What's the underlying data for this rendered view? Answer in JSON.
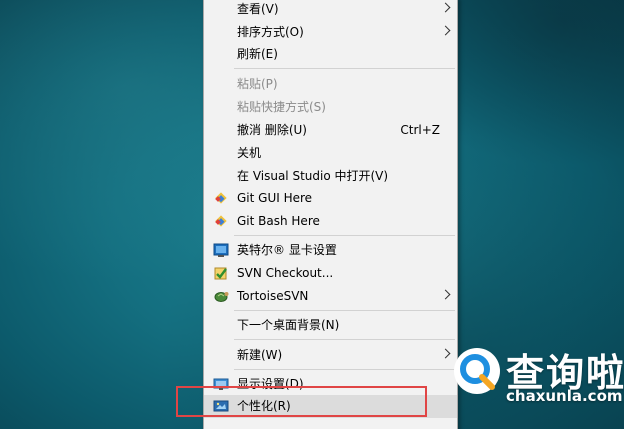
{
  "menu": {
    "items": [
      {
        "label": "查看(V)",
        "submenu": true
      },
      {
        "label": "排序方式(O)",
        "submenu": true
      },
      {
        "label": "刷新(E)"
      },
      {
        "label": "粘贴(P)",
        "disabled": true
      },
      {
        "label": "粘贴快捷方式(S)",
        "disabled": true
      },
      {
        "label": "撤消 删除(U)",
        "shortcut": "Ctrl+Z"
      },
      {
        "label": "关机"
      },
      {
        "label": "在 Visual Studio 中打开(V)"
      },
      {
        "label": "Git GUI Here",
        "icon": "git-icon"
      },
      {
        "label": "Git Bash Here",
        "icon": "git-icon"
      },
      {
        "label": "英特尔® 显卡设置",
        "icon": "intel-graphics-icon"
      },
      {
        "label": "SVN Checkout...",
        "icon": "svn-checkout-icon"
      },
      {
        "label": "TortoiseSVN",
        "icon": "tortoise-icon",
        "submenu": true
      },
      {
        "label": "下一个桌面背景(N)"
      },
      {
        "label": "新建(W)",
        "submenu": true
      },
      {
        "label": "显示设置(D)",
        "icon": "display-icon"
      },
      {
        "label": "个性化(R)",
        "icon": "personalize-icon",
        "hovered": true
      }
    ]
  },
  "watermark": {
    "title": "查询啦",
    "url": "chaxunla.com"
  },
  "colors": {
    "highlight_border": "#e04545",
    "menu_background": "#f2f2f2",
    "desktop": "#146f80"
  }
}
